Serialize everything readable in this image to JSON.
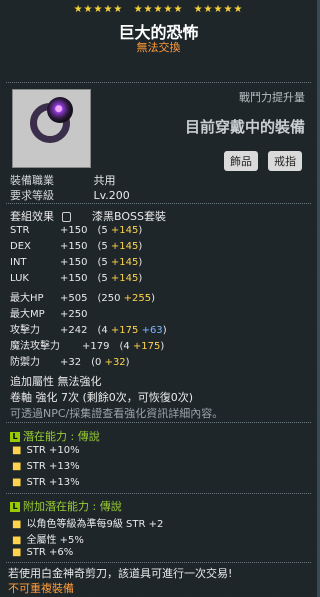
{
  "header": {
    "stars_groups": [
      "★★★★★",
      "★★★★★",
      "★★★★★"
    ],
    "title": "巨大的恐怖",
    "subtitle": "無法交換"
  },
  "item": {
    "icon": "black-ring-icon",
    "power_label": "戰鬥力提升量",
    "equip_note": "目前穿戴中的裝備",
    "tag_left": "飾品",
    "tag_right": "戒指"
  },
  "info": {
    "job_label": "裝備職業",
    "job_value": "共用",
    "level_label": "要求等級",
    "level_value": "Lv.200",
    "set_label": "套組效果",
    "set_value": "漆黑BOSS套裝"
  },
  "stats": [
    {
      "name": "STR",
      "base": "+150",
      "detail": "(5 ",
      "bonus": "+145",
      "close": ")"
    },
    {
      "name": "DEX",
      "base": "+150",
      "detail": "(5 ",
      "bonus": "+145",
      "close": ")"
    },
    {
      "name": "INT",
      "base": "+150",
      "detail": "(5 ",
      "bonus": "+145",
      "close": ")"
    },
    {
      "name": "LUK",
      "base": "+150",
      "detail": "(5 ",
      "bonus": "+145",
      "close": ")"
    },
    {
      "name": "最大HP",
      "base": "+505",
      "detail": "(250 ",
      "bonus": "+255",
      "close": ")"
    },
    {
      "name": "最大MP",
      "base": "+250",
      "detail": "",
      "bonus": "",
      "close": ""
    },
    {
      "name": "攻擊力",
      "base": "+242",
      "detail": "(4 ",
      "bonus": "+175",
      "extra": " +63",
      "close": ")"
    },
    {
      "name": "魔法攻擊力",
      "base": "+179",
      "detail": "(4 ",
      "bonus": "+175",
      "close": ")"
    },
    {
      "name": "防禦力",
      "base": "+32",
      "detail": "(0 ",
      "bonus": "+32",
      "close": ")"
    }
  ],
  "extra": {
    "attr_line": "追加屬性 無法強化",
    "scroll_line": "卷軸 強化 7次 (剩餘0次，可恢復0次)",
    "npc_line": "可透過NPC/採集證查看強化資訊詳細內容。"
  },
  "potential": {
    "icon_letter": "L",
    "title": "潛在能力 : 傳說",
    "lines": [
      "STR +10%",
      "STR +13%",
      "STR +13%"
    ]
  },
  "additional": {
    "icon_letter": "L",
    "title": "附加潛在能力 : 傳說",
    "lines": [
      "以角色等級為準每9級 STR +2",
      "全屬性 +5%",
      "STR +6%"
    ]
  },
  "footer": {
    "note": "若使用白金神奇剪刀，該道具可進行一次交易!",
    "warning": "不可重複裝備"
  },
  "colors": {
    "title": "#ffffff",
    "orange": "#ff9b3a",
    "bonus": "#ffd34b",
    "blue": "#7fb6ff",
    "potential": "#99cc33"
  }
}
